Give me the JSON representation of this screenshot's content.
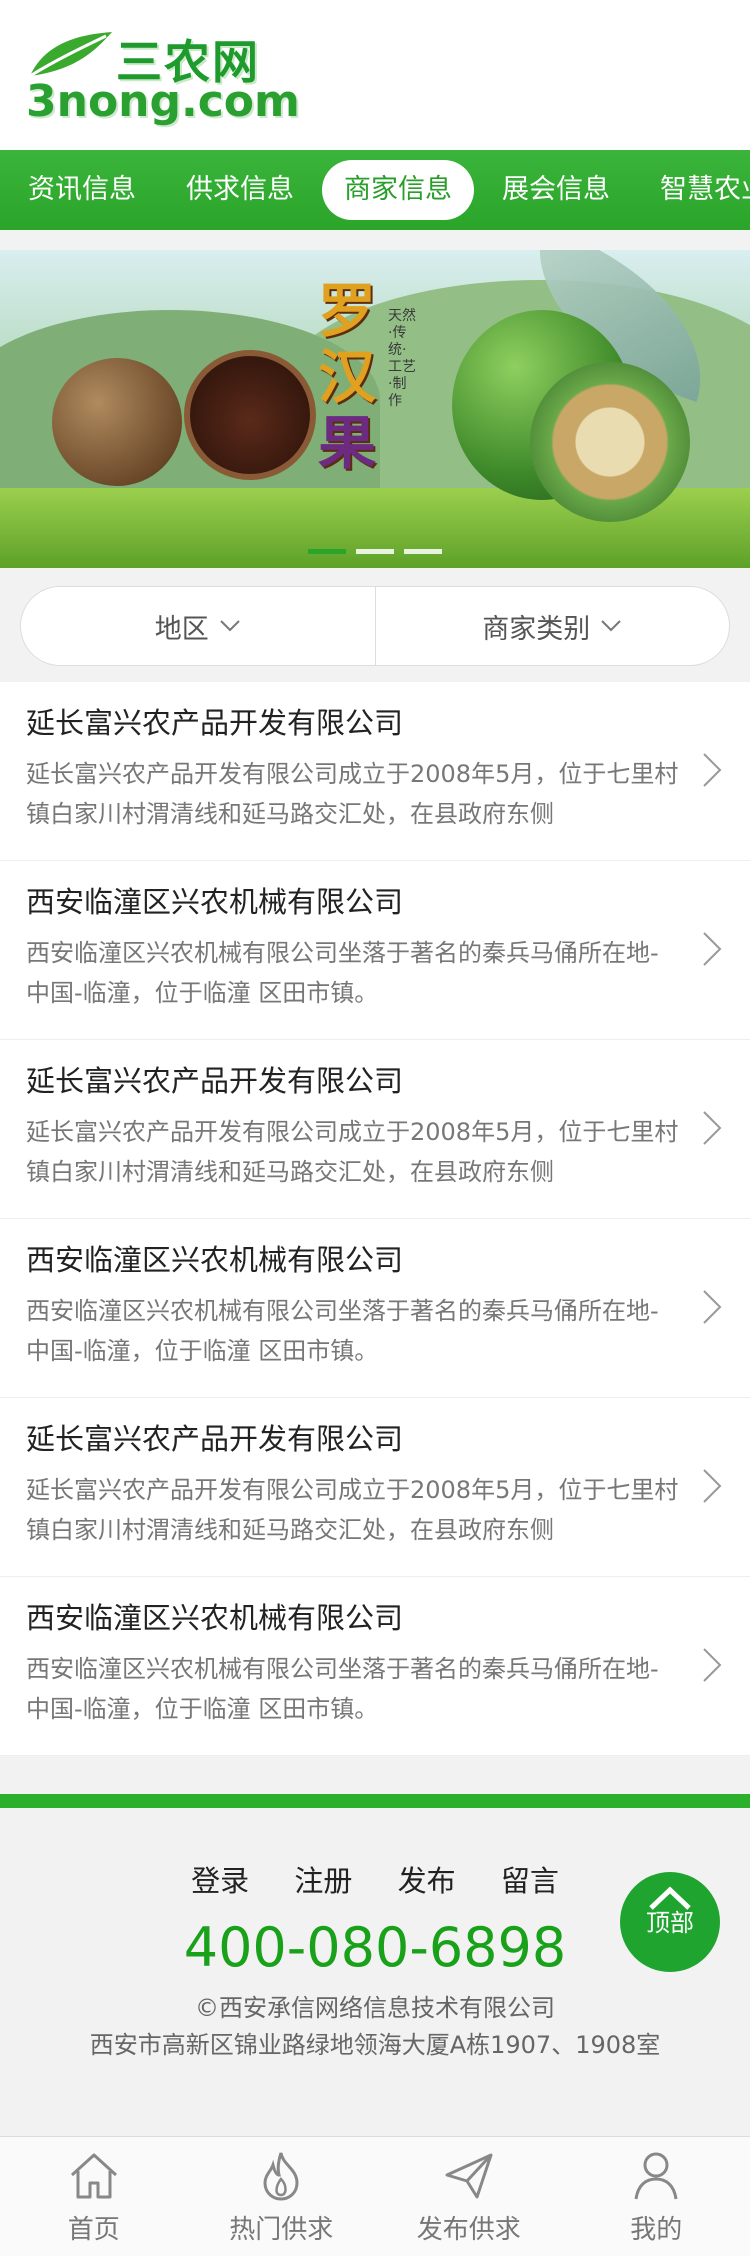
{
  "logo": {
    "cn": "三农网",
    "en": "3nong.com"
  },
  "nav": [
    "资讯信息",
    "供求信息",
    "商家信息",
    "展会信息",
    "智慧农业"
  ],
  "nav_active": "商家信息",
  "banner": {
    "title_chars": [
      "罗",
      "汉",
      "果"
    ],
    "subtitle": "天然·传统·工艺·制作",
    "slides": 3,
    "active_slide": 1
  },
  "filter": {
    "region": "地区",
    "category": "商家类别"
  },
  "companies": [
    {
      "name": "延长富兴农产品开发有限公司",
      "desc": "延长富兴农产品开发有限公司成立于2008年5月，位于七里村镇白家川村渭清线和延马路交汇处，在县政府东侧"
    },
    {
      "name": "西安临潼区兴农机械有限公司",
      "desc": "西安临潼区兴农机械有限公司坐落于著名的秦兵马俑所在地-中国-临潼，位于临潼 区田市镇。"
    },
    {
      "name": "延长富兴农产品开发有限公司",
      "desc": "延长富兴农产品开发有限公司成立于2008年5月，位于七里村镇白家川村渭清线和延马路交汇处，在县政府东侧"
    },
    {
      "name": "西安临潼区兴农机械有限公司",
      "desc": "西安临潼区兴农机械有限公司坐落于著名的秦兵马俑所在地-中国-临潼，位于临潼 区田市镇。"
    },
    {
      "name": "延长富兴农产品开发有限公司",
      "desc": "延长富兴农产品开发有限公司成立于2008年5月，位于七里村镇白家川村渭清线和延马路交汇处，在县政府东侧"
    },
    {
      "name": "西安临潼区兴农机械有限公司",
      "desc": "西安临潼区兴农机械有限公司坐落于著名的秦兵马俑所在地-中国-临潼，位于临潼 区田市镇。"
    }
  ],
  "footer": {
    "links": [
      "登录",
      "注册",
      "发布",
      "留言"
    ],
    "phone": "400-080-6898",
    "copyright": "©西安承信网络信息技术有限公司",
    "address": "西安市高新区锦业路绿地领海大厦A栋1907、1908室",
    "top_label": "顶部"
  },
  "tabbar": [
    {
      "label": "首页",
      "icon": "home-icon"
    },
    {
      "label": "热门供求",
      "icon": "flame-icon"
    },
    {
      "label": "发布供求",
      "icon": "send-icon"
    },
    {
      "label": "我的",
      "icon": "user-icon"
    }
  ],
  "colors": {
    "brand_green": "#2aa52a",
    "phone_green": "#1aa11a"
  }
}
